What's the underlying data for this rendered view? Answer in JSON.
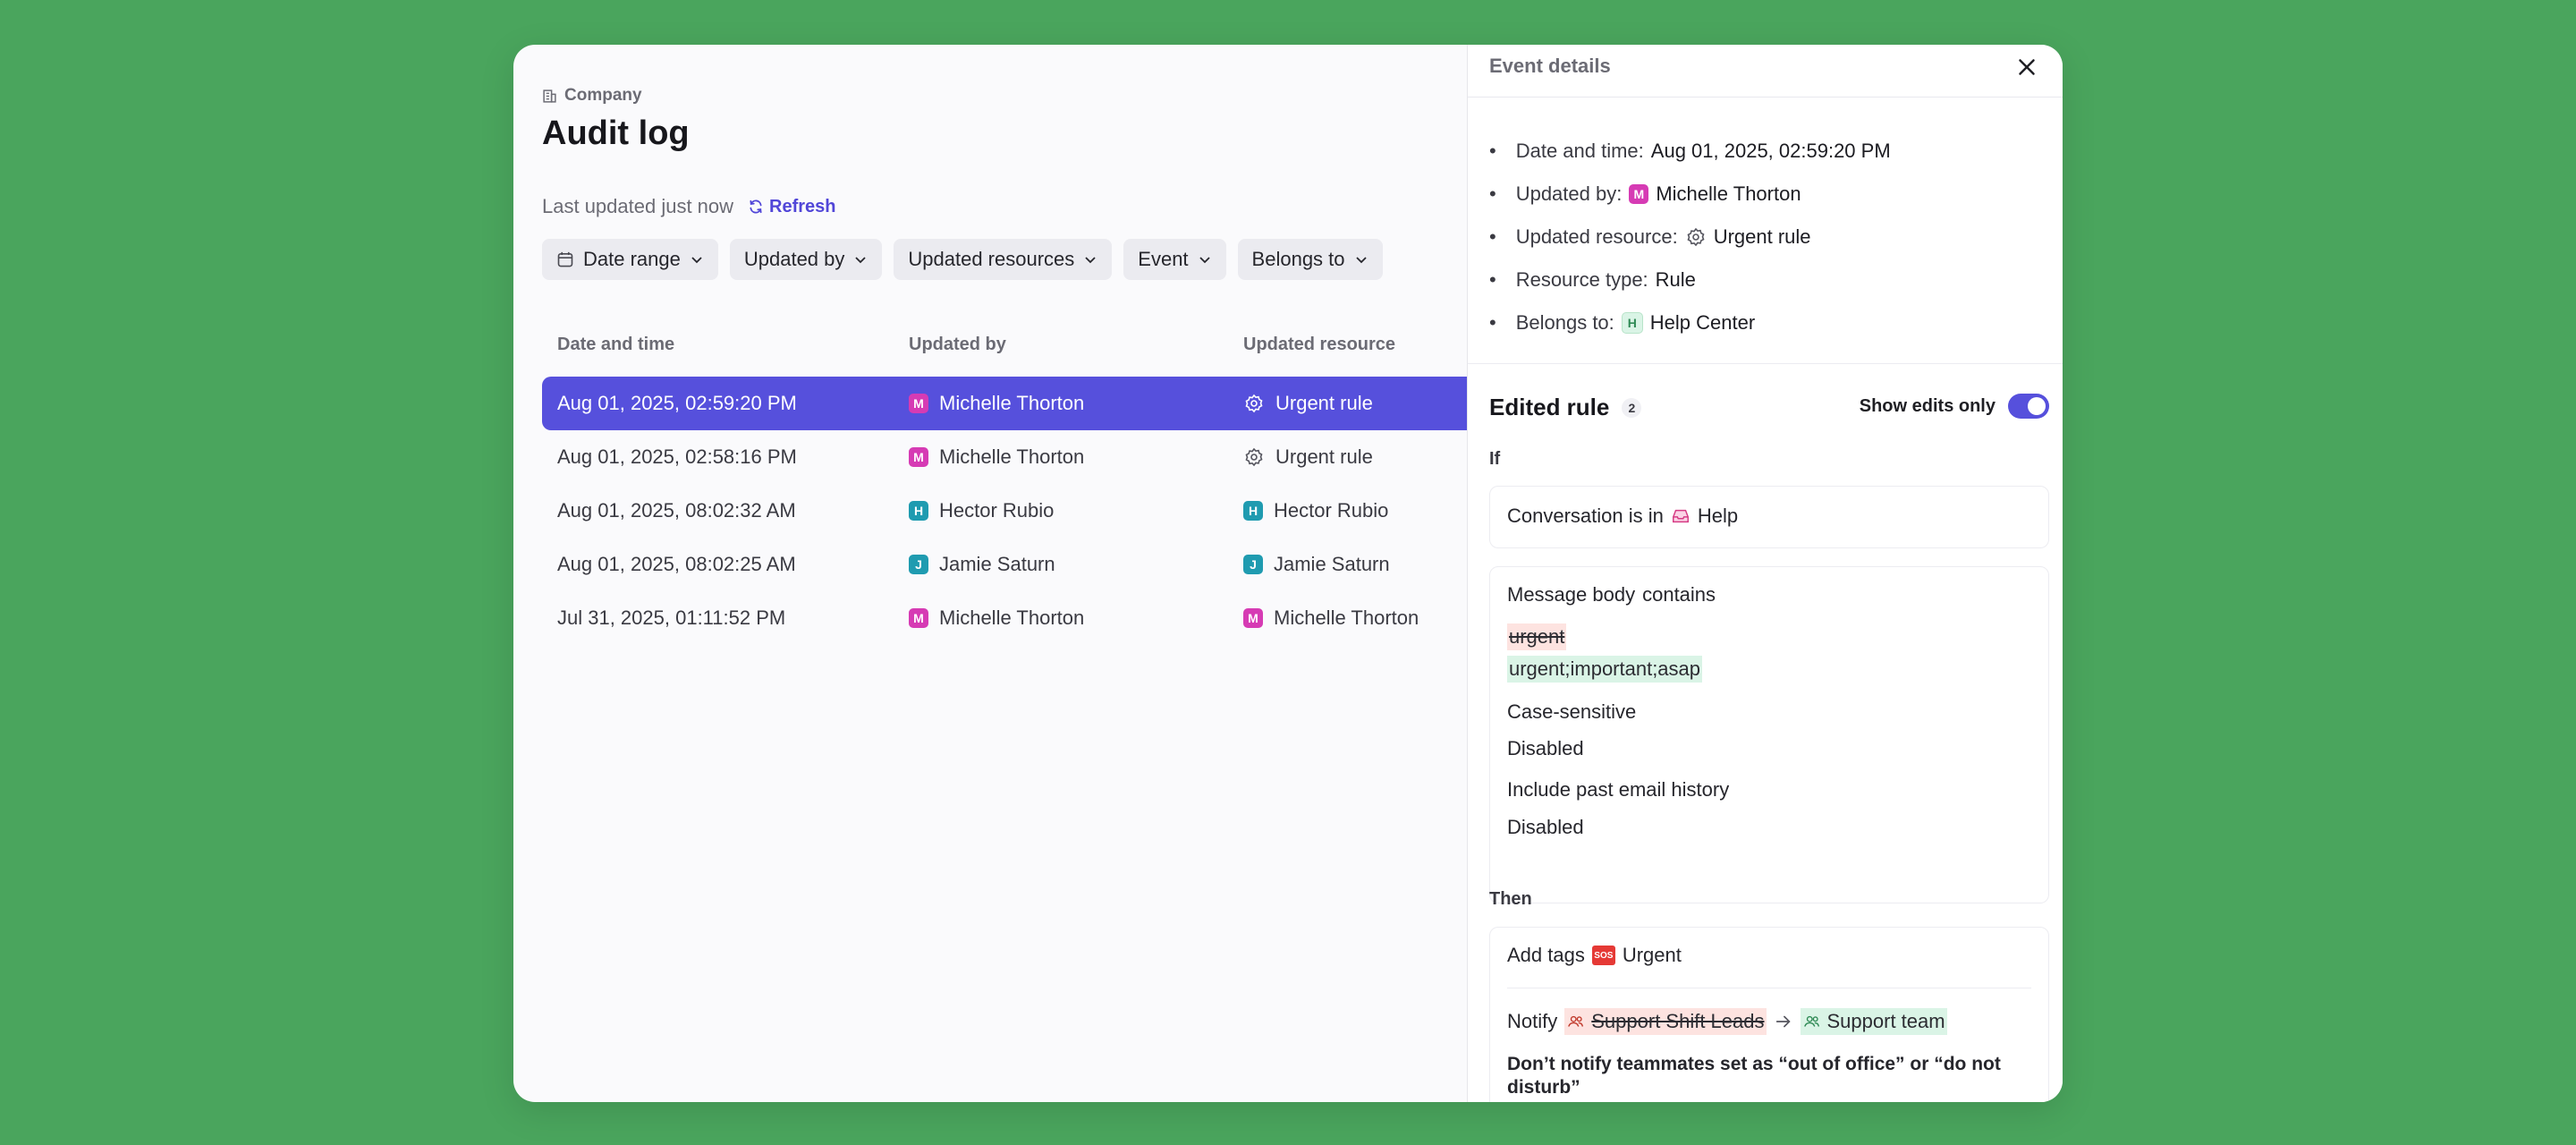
{
  "breadcrumb": "Company",
  "page_title": "Audit log",
  "last_updated": "Last updated just now",
  "refresh_label": "Refresh",
  "filters": [
    "Date range",
    "Updated by",
    "Updated resources",
    "Event",
    "Belongs to"
  ],
  "columns": [
    "Date and time",
    "Updated by",
    "Updated resource"
  ],
  "rows": [
    {
      "date": "Aug 01, 2025, 02:59:20 PM",
      "user": "Michelle Thorton",
      "user_initial": "M",
      "user_color": "#d63bb4",
      "resource": "Urgent rule",
      "resource_icon": "gear-icon"
    },
    {
      "date": "Aug 01, 2025, 02:58:16 PM",
      "user": "Michelle Thorton",
      "user_initial": "M",
      "user_color": "#d63bb4",
      "resource": "Urgent rule",
      "resource_icon": "gear-icon"
    },
    {
      "date": "Aug 01, 2025, 08:02:32 AM",
      "user": "Hector Rubio",
      "user_initial": "H",
      "user_color": "#1f9bb0",
      "resource": "Hector Rubio",
      "resource_icon": "avatar",
      "resource_initial": "H",
      "resource_color": "#1f9bb0"
    },
    {
      "date": "Aug 01, 2025, 08:02:25 AM",
      "user": "Jamie Saturn",
      "user_initial": "J",
      "user_color": "#1f9bb0",
      "resource": "Jamie Saturn",
      "resource_icon": "avatar",
      "resource_initial": "J",
      "resource_color": "#1f9bb0"
    },
    {
      "date": "Jul 31, 2025, 01:11:52 PM",
      "user": "Michelle Thorton",
      "user_initial": "M",
      "user_color": "#d63bb4",
      "resource": "Michelle Thorton",
      "resource_icon": "avatar",
      "resource_initial": "M",
      "resource_color": "#d63bb4"
    }
  ],
  "panel": {
    "title": "Event details",
    "details": {
      "date_label": "Date and time:",
      "date_value": "Aug 01, 2025, 02:59:20 PM",
      "updated_by_label": "Updated by:",
      "updated_by_initial": "M",
      "updated_by_value": "Michelle Thorton",
      "updated_resource_label": "Updated resource:",
      "updated_resource_value": "Urgent rule",
      "resource_type_label": "Resource type:",
      "resource_type_value": "Rule",
      "belongs_to_label": "Belongs to:",
      "belongs_to_initial": "H",
      "belongs_to_value": "Help Center"
    },
    "edited_title": "Edited rule",
    "edited_count": "2",
    "show_edits_label": "Show edits only",
    "show_edits_on": true,
    "if_label": "If",
    "condition_prefix": "Conversation is in",
    "condition_value": "Help",
    "message_body_prefix": "Message body",
    "message_body_op": "contains",
    "removed_value": "urgent",
    "added_value": "urgent;important;asap",
    "case_label": "Case-sensitive",
    "case_value": "Disabled",
    "history_label": "Include past email history",
    "history_value": "Disabled",
    "then_label": "Then",
    "add_tags_prefix": "Add tags",
    "tag_icon_text": "SOS",
    "tag_value": "Urgent",
    "notify_prefix": "Notify",
    "notify_removed": "Support Shift Leads",
    "notify_added": "Support team",
    "dont_notify_text": "Don’t notify teammates set as “out of office” or “do not disturb”"
  },
  "colors": {
    "accent": "#5650dc",
    "background": "#4aa55d",
    "magenta": "#d63bb4",
    "teal": "#1f9bb0",
    "diff_removed": "#fde3e0",
    "diff_added": "#daf4e6"
  }
}
